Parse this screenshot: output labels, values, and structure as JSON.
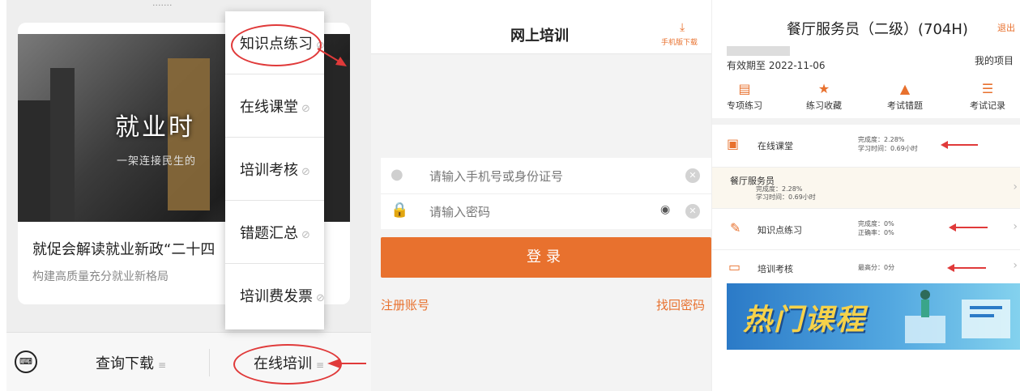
{
  "panel1": {
    "status_text": "·······",
    "article": {
      "image_headline": "就业时",
      "image_subhead": "一架连接民生的",
      "title": "就促会解读就业新政“二十四",
      "subtitle": "构建高质量充分就业新格局"
    },
    "dropdown": [
      {
        "label": "知识点练习"
      },
      {
        "label": "在线课堂"
      },
      {
        "label": "培训考核"
      },
      {
        "label": "错题汇总"
      },
      {
        "label": "培训费发票"
      }
    ],
    "bottom_nav": {
      "keyboard_icon": "keyboard-icon",
      "query_label": "查询下载",
      "online_label": "在线培训"
    },
    "accent": "#e03a3a"
  },
  "panel2": {
    "title": "网上培训",
    "download_label": "手机版下载",
    "phone_placeholder": "请输入手机号或身份证号",
    "password_placeholder": "请输入密码",
    "login_label": "登录",
    "register_label": "注册账号",
    "forgot_label": "找回密码",
    "accent": "#e8712e"
  },
  "panel3": {
    "title": "餐厅服务员（二级）(704H)",
    "logout_label": "退出",
    "valid_until": "有效期至 2022-11-06",
    "my_projects": "我的项目",
    "quick_icons": [
      {
        "label": "专项练习",
        "icon": "list-icon"
      },
      {
        "label": "练习收藏",
        "icon": "star-icon"
      },
      {
        "label": "考试错题",
        "icon": "warning-icon"
      },
      {
        "label": "考试记录",
        "icon": "record-icon"
      }
    ],
    "online_class": {
      "label": "在线课堂",
      "completion": "完成度：2.28%",
      "study_time": "学习时间：0.69小时"
    },
    "sub_course": {
      "label": "餐厅服务员",
      "completion": "完成度：2.28%",
      "study_time": "学习时间：0.69小时"
    },
    "knowledge_practice": {
      "label": "知识点练习",
      "completion": "完成度：0%",
      "accuracy": "正确率：0%"
    },
    "training_exam": {
      "label": "培训考核",
      "highest": "最高分：0分"
    },
    "banner_text": "热门课程"
  }
}
